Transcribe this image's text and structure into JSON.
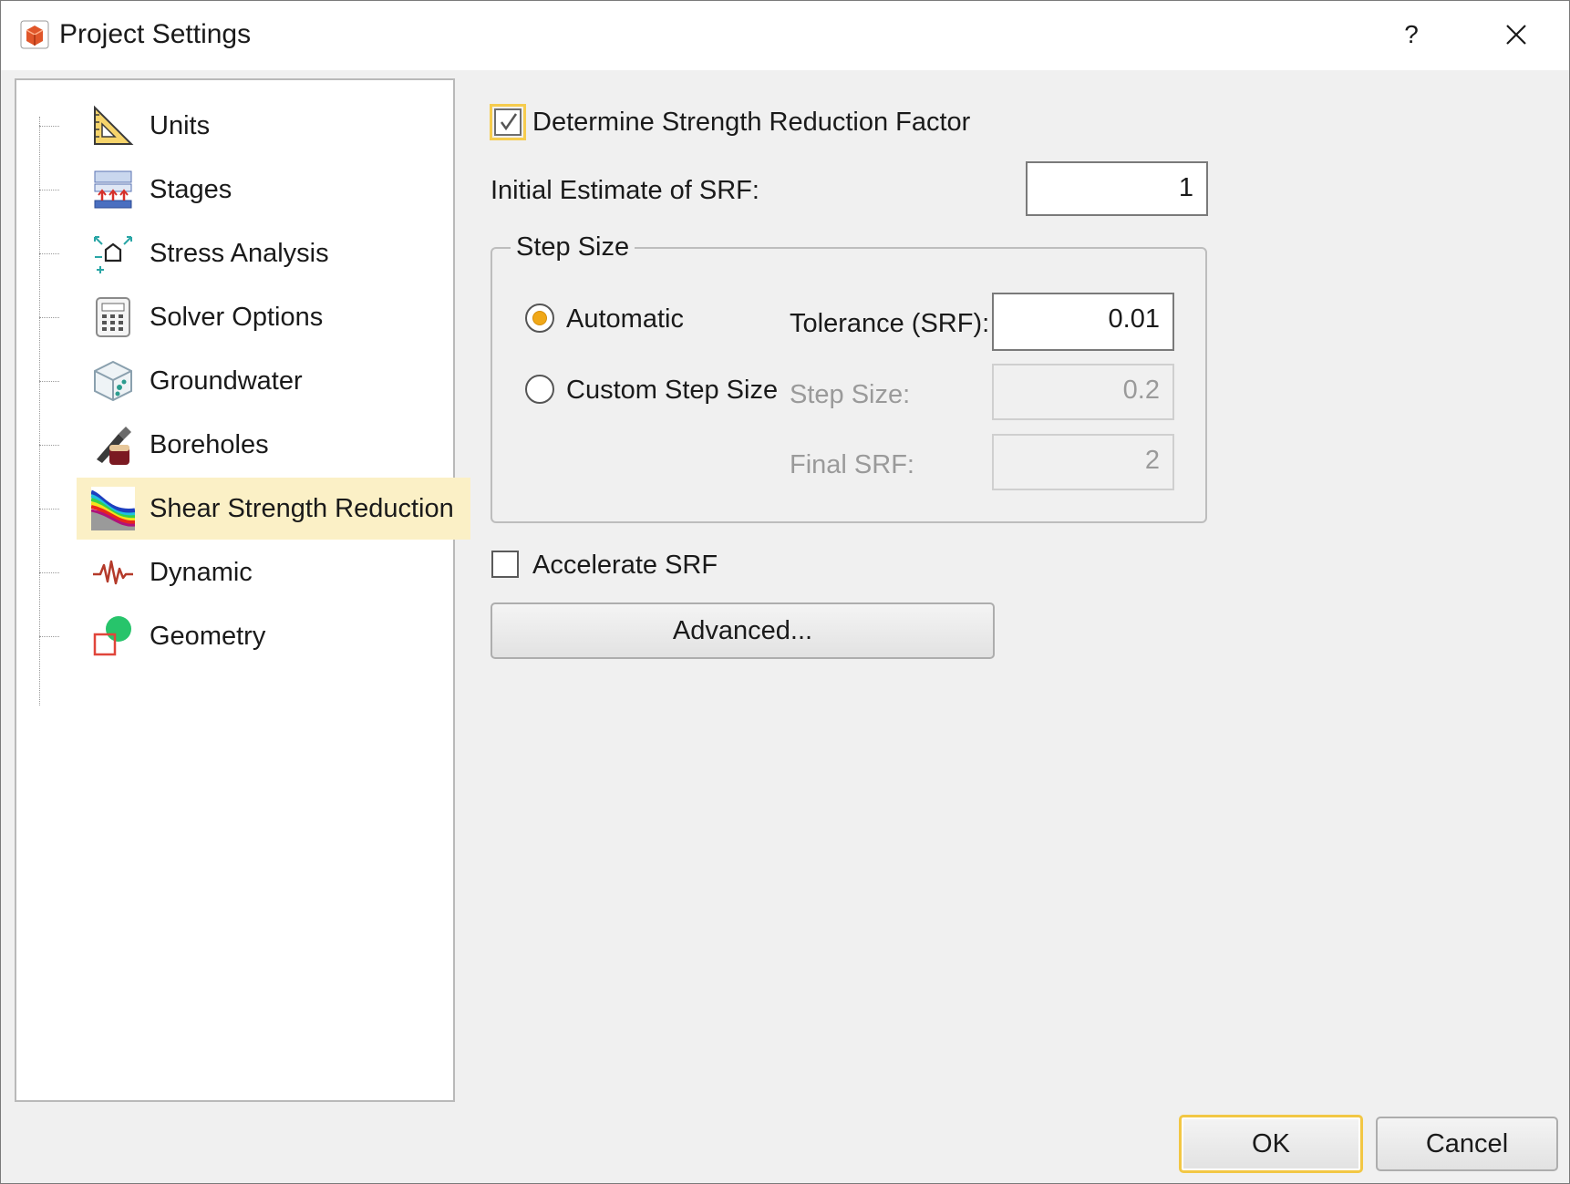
{
  "window": {
    "title": "Project Settings",
    "help_label": "?",
    "icons": {
      "app": "settings-app-icon",
      "close": "close-icon"
    }
  },
  "sidebar": {
    "selected": "Shear Strength Reduction",
    "items": [
      {
        "label": "Units",
        "icon": "set-square-icon"
      },
      {
        "label": "Stages",
        "icon": "stages-icon"
      },
      {
        "label": "Stress Analysis",
        "icon": "stress-analysis-icon"
      },
      {
        "label": "Solver Options",
        "icon": "calculator-icon"
      },
      {
        "label": "Groundwater",
        "icon": "groundwater-cube-icon"
      },
      {
        "label": "Boreholes",
        "icon": "borehole-icon"
      },
      {
        "label": "Shear Strength Reduction",
        "icon": "shear-strength-contour-icon"
      },
      {
        "label": "Dynamic",
        "icon": "waveform-icon"
      },
      {
        "label": "Geometry",
        "icon": "geometry-shapes-icon"
      }
    ]
  },
  "main": {
    "determine_srf": {
      "label": "Determine Strength Reduction Factor",
      "checked": true
    },
    "initial_estimate": {
      "label": "Initial Estimate of SRF:",
      "value": "1"
    },
    "step_size_group": {
      "title": "Step Size",
      "automatic": {
        "label": "Automatic",
        "selected": true
      },
      "custom": {
        "label": "Custom Step Size",
        "selected": false
      },
      "tolerance": {
        "label": "Tolerance (SRF):",
        "value": "0.01"
      },
      "step_size": {
        "label": "Step Size:",
        "value": "0.2",
        "disabled": true
      },
      "final_srf": {
        "label": "Final SRF:",
        "value": "2",
        "disabled": true
      }
    },
    "accelerate_srf": {
      "label": "Accelerate SRF",
      "checked": false
    },
    "advanced_label": "Advanced..."
  },
  "footer": {
    "ok_label": "OK",
    "cancel_label": "Cancel"
  },
  "colors": {
    "selection": "#fbf0c6",
    "focus": "#f2c744",
    "radio_dot": "#f0a818",
    "dialog_bg": "#f0f0f0"
  }
}
